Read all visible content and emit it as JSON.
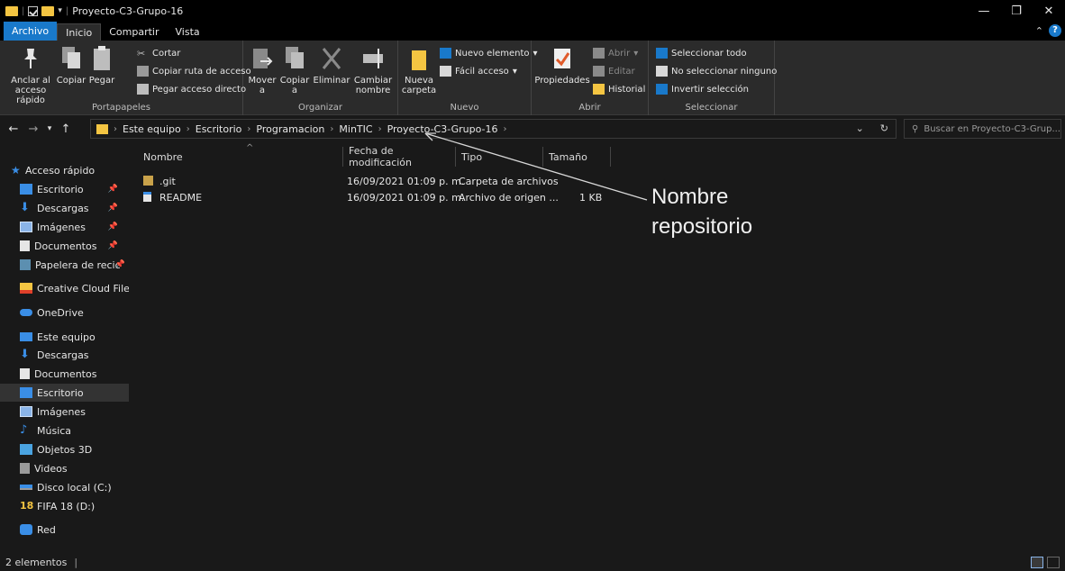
{
  "window": {
    "title": "Proyecto-C3-Grupo-16",
    "minimize": "—",
    "maximize": "❐",
    "close": "✕"
  },
  "tabs": [
    "Archivo",
    "Inicio",
    "Compartir",
    "Vista"
  ],
  "ribbon": {
    "portapapeles": {
      "label": "Portapapeles",
      "pin": "Anclar al acceso rápido",
      "copy": "Copiar",
      "paste": "Pegar",
      "cut": "Cortar",
      "copy_path": "Copiar ruta de acceso",
      "paste_shortcut": "Pegar acceso directo"
    },
    "organizar": {
      "label": "Organizar",
      "move": "Mover a",
      "copy_to": "Copiar a",
      "delete": "Eliminar",
      "rename": "Cambiar nombre"
    },
    "nuevo": {
      "label": "Nuevo",
      "new_folder": "Nueva carpeta",
      "new_item": "Nuevo elemento",
      "easy_access": "Fácil acceso"
    },
    "abrir": {
      "label": "Abrir",
      "properties": "Propiedades",
      "open": "Abrir",
      "edit": "Editar",
      "history": "Historial"
    },
    "seleccionar": {
      "label": "Seleccionar",
      "select_all": "Seleccionar todo",
      "select_none": "No seleccionar ninguno",
      "invert": "Invertir selección"
    }
  },
  "breadcrumb": [
    "Este equipo",
    "Escritorio",
    "Programacion",
    "MinTIC",
    "Proyecto-C3-Grupo-16"
  ],
  "search": {
    "placeholder": "Buscar en Proyecto-C3-Grup..."
  },
  "sidebar": {
    "quick_access": "Acceso rápido",
    "items": [
      {
        "label": "Escritorio",
        "pinned": true
      },
      {
        "label": "Descargas",
        "pinned": true
      },
      {
        "label": "Imágenes",
        "pinned": true
      },
      {
        "label": "Documentos",
        "pinned": true
      },
      {
        "label": "Papelera de recic",
        "pinned": true
      }
    ],
    "creative_cloud": "Creative Cloud Files",
    "onedrive": "OneDrive",
    "this_pc": "Este equipo",
    "pc_items": [
      "Descargas",
      "Documentos",
      "Escritorio",
      "Imágenes",
      "Música",
      "Objetos 3D",
      "Videos",
      "Disco local (C:)",
      "FIFA 18 (D:)"
    ],
    "network": "Red"
  },
  "columns": [
    "Nombre",
    "Fecha de modificación",
    "Tipo",
    "Tamaño"
  ],
  "files": [
    {
      "name": ".git",
      "date": "16/09/2021 01:09 p. m.",
      "type": "Carpeta de archivos",
      "size": ""
    },
    {
      "name": "README",
      "date": "16/09/2021 01:09 p. m.",
      "type": "Archivo de origen ...",
      "size": "1 KB"
    }
  ],
  "annotation": {
    "line1": "Nombre",
    "line2": "repositorio"
  },
  "status": {
    "count": "2 elementos"
  },
  "colors": {
    "accent": "#1979ca",
    "folder": "#f4c542",
    "background": "#191919"
  }
}
